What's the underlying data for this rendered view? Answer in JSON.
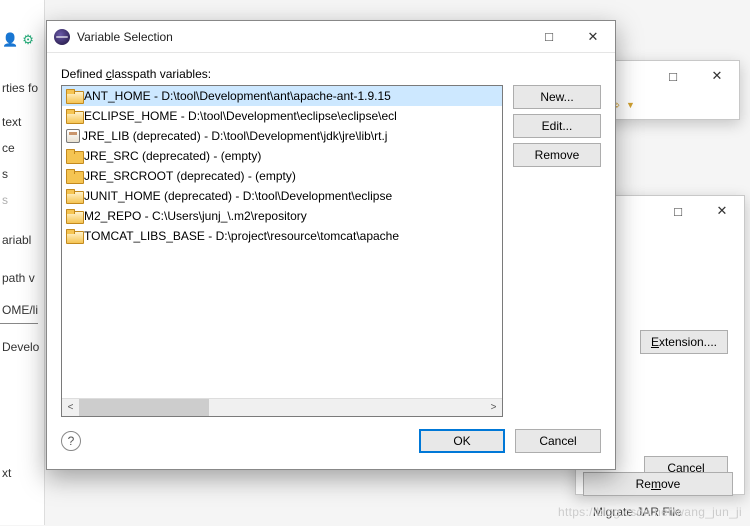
{
  "dialog": {
    "title": "Variable Selection",
    "label_prefix": "Defined ",
    "label_mnemonic": "c",
    "label_suffix": "lasspath variables:",
    "items": [
      {
        "icon": "folder-open",
        "text": "ANT_HOME - D:\\tool\\Development\\ant\\apache-ant-1.9.15",
        "selected": true
      },
      {
        "icon": "folder-open",
        "text": "ECLIPSE_HOME - D:\\tool\\Development\\eclipse\\eclipse\\ecl",
        "selected": false
      },
      {
        "icon": "jar",
        "text": "JRE_LIB (deprecated) - D:\\tool\\Development\\jdk\\jre\\lib\\rt.j",
        "selected": false
      },
      {
        "icon": "folder",
        "text": "JRE_SRC (deprecated) - (empty)",
        "selected": false
      },
      {
        "icon": "folder",
        "text": "JRE_SRCROOT (deprecated) - (empty)",
        "selected": false
      },
      {
        "icon": "folder-open",
        "text": "JUNIT_HOME (deprecated) - D:\\tool\\Development\\eclipse",
        "selected": false
      },
      {
        "icon": "folder-open",
        "text": "M2_REPO - C:\\Users\\junj_\\.m2\\repository",
        "selected": false
      },
      {
        "icon": "folder-open",
        "text": "TOMCAT_LIBS_BASE - D:\\project\\resource\\tomcat\\apache",
        "selected": false
      }
    ],
    "side_buttons": {
      "new": "New...",
      "edit": "Edit...",
      "remove": "Remove"
    },
    "footer": {
      "ok": "OK",
      "cancel": "Cancel"
    }
  },
  "bg": {
    "left_labels": [
      "rties fo",
      "text",
      "ce",
      "s",
      "s",
      "ariabl",
      "path v",
      "OME/li",
      "Develo",
      "",
      "",
      "",
      "",
      "xt"
    ],
    "window_b": {
      "extension": "Extension....",
      "cancel": "Cancel"
    },
    "bottom": {
      "remove": "Remove",
      "migrate": "Migrate JAR File"
    }
  },
  "watermark": "https://blog.csdn.net/wang_jun_ji"
}
